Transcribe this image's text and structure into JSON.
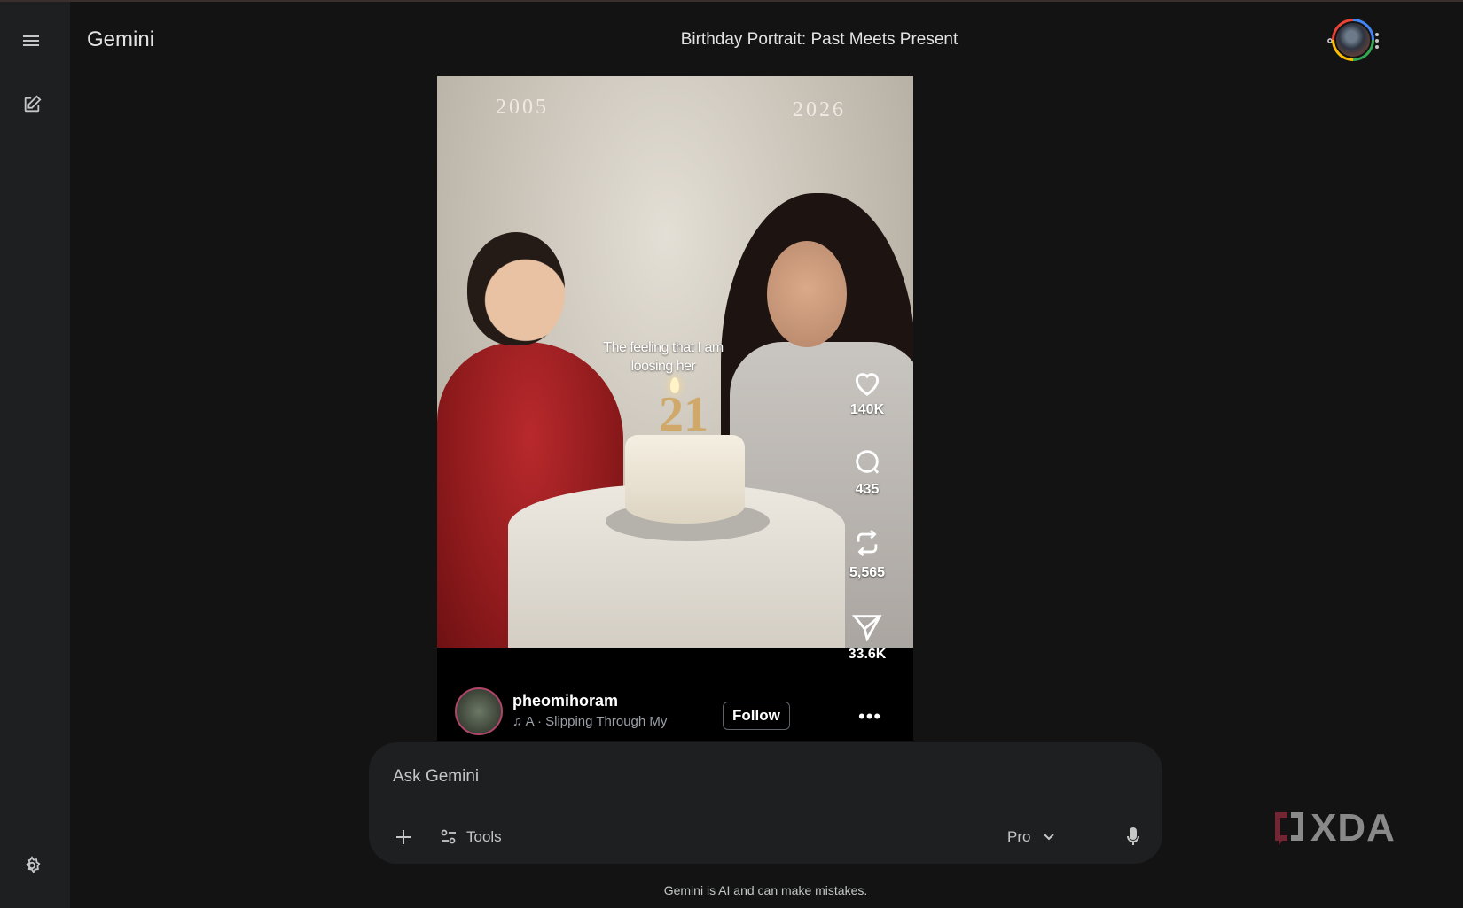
{
  "header": {
    "app_name": "Gemini",
    "conversation_title": "Birthday Portrait: Past Meets Present"
  },
  "sidebar": {
    "menu_icon": "menu-icon",
    "new_chat_icon": "edit-icon",
    "settings_icon": "settings-icon"
  },
  "top_actions": {
    "share_icon": "share-icon",
    "more_icon": "more-vert-icon"
  },
  "media": {
    "year_left": "2005",
    "year_right": "2026",
    "caption": "The feeling that I am loosing her",
    "candle_number": "21",
    "likes": "140K",
    "comments": "435",
    "reposts": "5,565",
    "shares": "33.6K",
    "username": "pheomihoram",
    "track": "A · Slipping Through My",
    "follow_label": "Follow",
    "more_label": "•••"
  },
  "composer": {
    "placeholder": "Ask Gemini",
    "tools_label": "Tools",
    "model_label": "Pro"
  },
  "footer": {
    "disclaimer": "Gemini is AI and can make mistakes."
  },
  "watermark": {
    "text": "XDA"
  },
  "colors": {
    "background": "#131314",
    "surface": "#1e1f20",
    "text": "#e3e3e3",
    "muted": "#c4c7c5"
  }
}
